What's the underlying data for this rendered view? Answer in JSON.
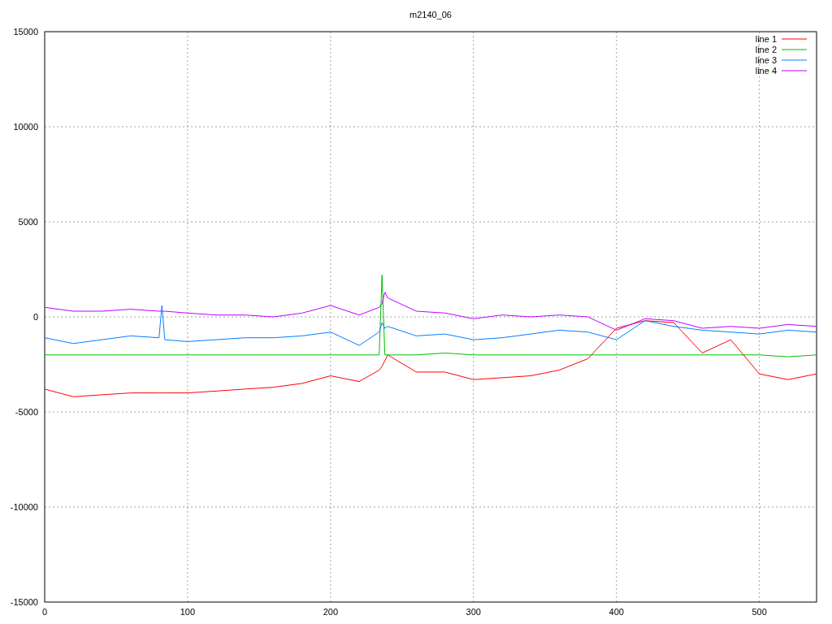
{
  "chart_data": {
    "type": "line",
    "title": "m2140_06",
    "x": [
      0,
      20,
      40,
      60,
      80,
      82,
      84,
      100,
      120,
      140,
      160,
      180,
      200,
      220,
      234,
      236,
      238,
      240,
      260,
      280,
      300,
      320,
      340,
      360,
      380,
      400,
      420,
      440,
      460,
      480,
      500,
      520,
      540
    ],
    "series": [
      {
        "name": "line 1",
        "color": "#ff0000",
        "values": [
          -3800,
          -4200,
          -4100,
          -4000,
          -4000,
          -4000,
          -4000,
          -4000,
          -3900,
          -3800,
          -3700,
          -3500,
          -3100,
          -3400,
          -2800,
          -2600,
          -2300,
          -2000,
          -2900,
          -2900,
          -3300,
          -3200,
          -3100,
          -2800,
          -2200,
          -600,
          -200,
          -300,
          -1900,
          -1200,
          -3000,
          -3300,
          -3000
        ]
      },
      {
        "name": "line 2",
        "color": "#00c000",
        "values": [
          -2000,
          -2000,
          -2000,
          -2000,
          -2000,
          -2000,
          -2000,
          -2000,
          -2000,
          -2000,
          -2000,
          -2000,
          -2000,
          -2000,
          -2000,
          2200,
          -2000,
          -2000,
          -2000,
          -1900,
          -2000,
          -2000,
          -2000,
          -2000,
          -2000,
          -2000,
          -2000,
          -2000,
          -2000,
          -2000,
          -2000,
          -2100,
          -2000
        ]
      },
      {
        "name": "line 3",
        "color": "#0080ff",
        "values": [
          -1100,
          -1400,
          -1200,
          -1000,
          -1100,
          600,
          -1200,
          -1300,
          -1200,
          -1100,
          -1100,
          -1000,
          -800,
          -1500,
          -800,
          -300,
          -600,
          -500,
          -1000,
          -900,
          -1200,
          -1100,
          -900,
          -700,
          -800,
          -1200,
          -200,
          -500,
          -700,
          -800,
          -900,
          -700,
          -800
        ]
      },
      {
        "name": "line 4",
        "color": "#c000ff",
        "values": [
          500,
          300,
          300,
          400,
          300,
          300,
          300,
          200,
          100,
          100,
          0,
          200,
          600,
          100,
          500,
          700,
          1300,
          1000,
          300,
          200,
          -100,
          100,
          0,
          100,
          0,
          -700,
          -100,
          -200,
          -600,
          -500,
          -600,
          -400,
          -500
        ]
      }
    ],
    "grid": true,
    "legend": true,
    "xlim": [
      0,
      540
    ],
    "ylim": [
      -15000,
      15000
    ],
    "xticks": [
      0,
      100,
      200,
      300,
      400,
      500
    ],
    "yticks": [
      -15000,
      -10000,
      -5000,
      0,
      5000,
      10000,
      15000
    ]
  }
}
